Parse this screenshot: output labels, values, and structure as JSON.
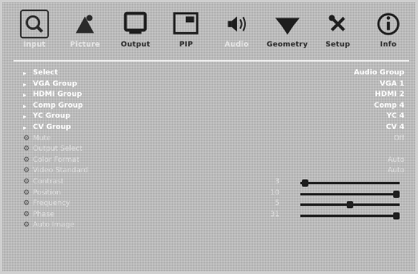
{
  "toolbar": {
    "items": [
      {
        "label": "Input",
        "icon": "magnifier-icon",
        "state": "dim"
      },
      {
        "label": "Picture",
        "icon": "picture-icon",
        "state": "dim"
      },
      {
        "label": "Output",
        "icon": "monitor-icon",
        "state": "normal"
      },
      {
        "label": "PIP",
        "icon": "pip-icon",
        "state": "normal"
      },
      {
        "label": "Audio",
        "icon": "speaker-icon",
        "state": "dim"
      },
      {
        "label": "Geometry",
        "icon": "geometry-icon",
        "state": "normal"
      },
      {
        "label": "Setup",
        "icon": "tools-icon",
        "state": "normal"
      },
      {
        "label": "Info",
        "icon": "info-icon",
        "state": "normal"
      }
    ]
  },
  "rows": [
    {
      "name": "Select",
      "value": "Audio Group",
      "kind": "item"
    },
    {
      "name": "VGA Group",
      "value": "VGA 1",
      "kind": "item"
    },
    {
      "name": "HDMI Group",
      "value": "HDMI 2",
      "kind": "item"
    },
    {
      "name": "Comp Group",
      "value": "Comp 4",
      "kind": "item"
    },
    {
      "name": "YC Group",
      "value": "YC 4",
      "kind": "item"
    },
    {
      "name": "CV Group",
      "value": "CV 4",
      "kind": "item"
    },
    {
      "name": "Mute",
      "value": "Off",
      "kind": "setting"
    },
    {
      "name": "Output Select",
      "value": "",
      "kind": "setting"
    },
    {
      "name": "Color Format",
      "value": "Auto",
      "kind": "setting"
    },
    {
      "name": "Video Standard",
      "value": "Auto",
      "kind": "setting"
    },
    {
      "name": "Contrast",
      "number": "3",
      "slider": 0.02,
      "kind": "slider"
    },
    {
      "name": "Position",
      "number": "10",
      "slider": 1.0,
      "kind": "slider"
    },
    {
      "name": "Frequency",
      "number": "5",
      "slider": 0.5,
      "kind": "slider"
    },
    {
      "name": "Phase",
      "number": "31",
      "slider": 1.0,
      "kind": "slider"
    },
    {
      "name": "Auto Image",
      "value": "",
      "kind": "setting"
    }
  ],
  "colors": {
    "background": "#bdbdbd",
    "text": "#ffffff",
    "slider": "#1e1e1e"
  }
}
